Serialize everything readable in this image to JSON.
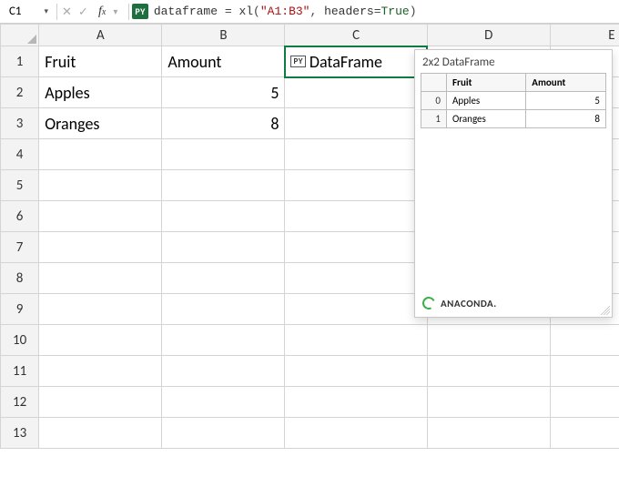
{
  "formula_bar": {
    "cell_ref": "C1",
    "py_badge": "PY",
    "formula_raw": "dataframe = xl(\"A1:B3\", headers=True)",
    "parts": {
      "var": "dataframe",
      "eq": " = ",
      "fn": "xl",
      "open": "(",
      "str": "\"A1:B3\"",
      "sep": ", ",
      "kw": "headers",
      "assign": "=",
      "bool": "True",
      "close": ")"
    }
  },
  "columns": [
    "A",
    "B",
    "C",
    "D",
    "E"
  ],
  "rows": [
    "1",
    "2",
    "3",
    "4",
    "5",
    "6",
    "7",
    "8",
    "9",
    "10",
    "11",
    "12",
    "13"
  ],
  "cells": {
    "A1": "Fruit",
    "B1": "Amount",
    "A2": "Apples",
    "B2": "5",
    "A3": "Oranges",
    "B3": "8",
    "C1_chip": "PY",
    "C1_label": "DataFrame"
  },
  "active_cell": "C1",
  "callout": {
    "title": "2x2 DataFrame",
    "headers": [
      "Fruit",
      "Amount"
    ],
    "rows": [
      {
        "idx": "0",
        "fruit": "Apples",
        "amount": "5"
      },
      {
        "idx": "1",
        "fruit": "Oranges",
        "amount": "8"
      }
    ],
    "footer_brand": "ANACONDA."
  },
  "chart_data": {
    "type": "table",
    "title": "2x2 DataFrame",
    "columns": [
      "Fruit",
      "Amount"
    ],
    "index": [
      0,
      1
    ],
    "data": [
      [
        "Apples",
        5
      ],
      [
        "Oranges",
        8
      ]
    ]
  }
}
